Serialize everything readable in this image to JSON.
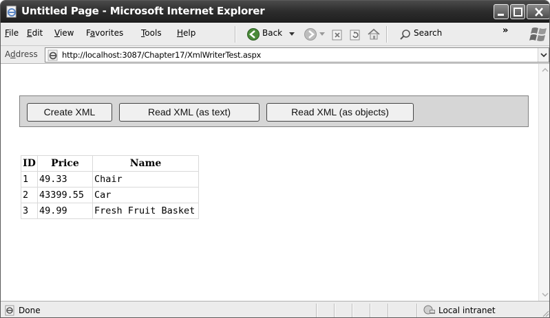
{
  "window": {
    "title": "Untitled Page - Microsoft Internet Explorer"
  },
  "menu": {
    "file": "ile",
    "file_key": "F",
    "edit": "dit",
    "edit_key": "E",
    "view": "iew",
    "view_key": "V",
    "favorites_pre": "F",
    "favorites_key": "a",
    "favorites_post": "vorites",
    "tools": "ools",
    "tools_key": "T",
    "help": "elp",
    "help_key": "H"
  },
  "toolbar": {
    "back_label": "Back",
    "search_label": "Search",
    "more": "»"
  },
  "address": {
    "label_pre": "A",
    "label_key": "d",
    "label_post": "dress",
    "url": "http://localhost:3087/Chapter17/XmlWriterTest.aspx"
  },
  "buttons": {
    "create": "Create XML",
    "read_text": "Read XML (as text)",
    "read_objects": "Read XML (as objects)"
  },
  "table": {
    "headers": [
      "ID",
      "Price",
      "Name"
    ],
    "rows": [
      {
        "id": "1",
        "price": "49.33",
        "name": "Chair"
      },
      {
        "id": "2",
        "price": "43399.55",
        "name": "Car"
      },
      {
        "id": "3",
        "price": "49.99",
        "name": "Fresh Fruit Basket"
      }
    ]
  },
  "status": {
    "text": "Done",
    "zone": "Local intranet"
  },
  "icons": {
    "title": "ie-page-icon",
    "back": "back-arrow-icon",
    "forward": "forward-arrow-icon",
    "stop": "stop-icon",
    "refresh": "refresh-icon",
    "home": "home-icon",
    "search": "search-icon",
    "windows_logo": "windows-logo-icon",
    "address": "ie-page-icon",
    "status": "page-icon",
    "zone": "intranet-icon"
  },
  "colors": {
    "title_bar": "#2d2d2d",
    "back_green": "#3a7a2a",
    "panel": "#d6d6d6"
  }
}
